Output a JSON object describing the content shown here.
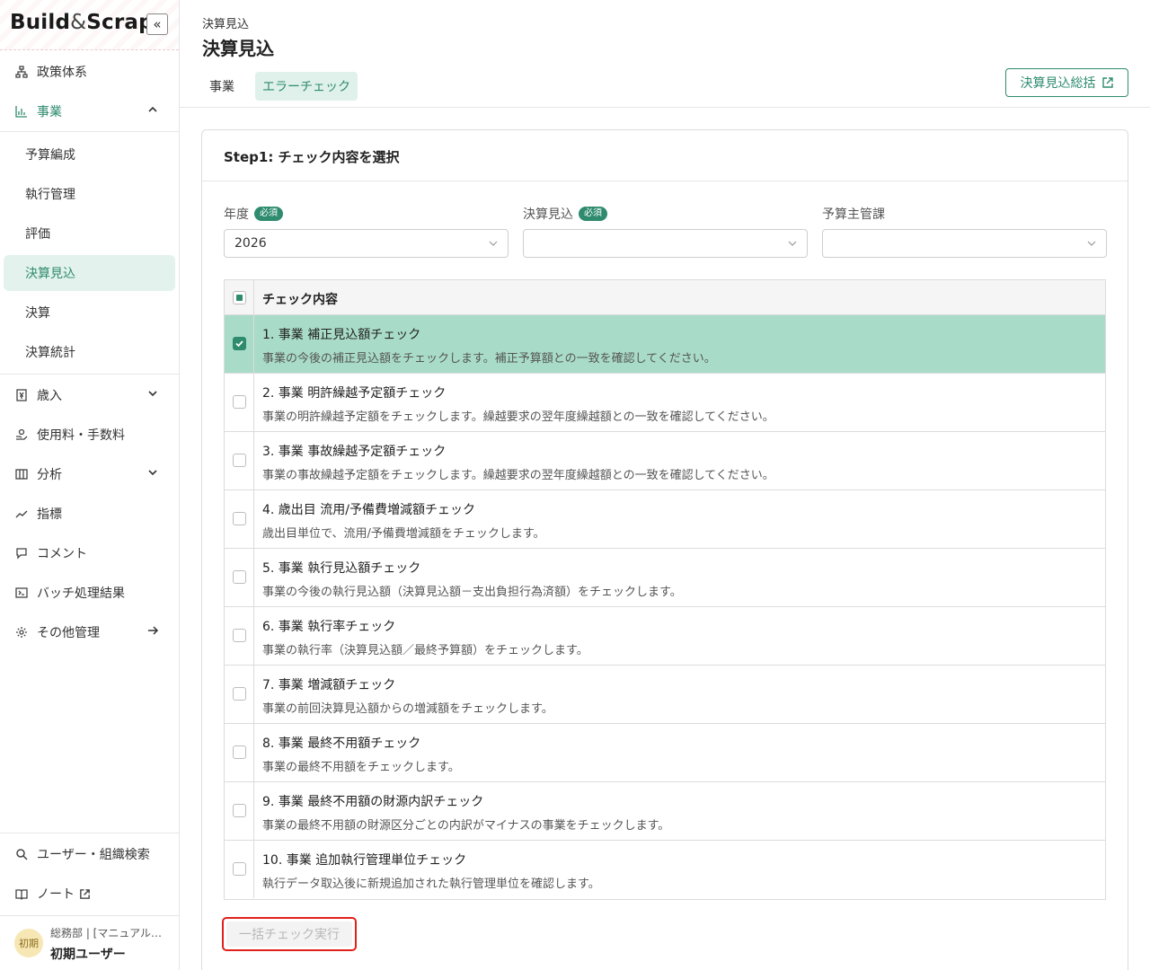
{
  "sidebar": {
    "logo_main": "Build",
    "logo_amp": "&",
    "logo_end": "Scrap",
    "collapse_label": "«",
    "items": [
      {
        "label": "政策体系"
      },
      {
        "label": "事業"
      },
      {
        "label": "歳入"
      },
      {
        "label": "使用料・手数料"
      },
      {
        "label": "分析"
      },
      {
        "label": "指標"
      },
      {
        "label": "コメント"
      },
      {
        "label": "バッチ処理結果"
      },
      {
        "label": "その他管理"
      }
    ],
    "sub_items": [
      {
        "label": "予算編成"
      },
      {
        "label": "執行管理"
      },
      {
        "label": "評価"
      },
      {
        "label": "決算見込"
      },
      {
        "label": "決算"
      },
      {
        "label": "決算統計"
      }
    ],
    "footer_items": [
      {
        "label": "ユーザー・組織検索"
      },
      {
        "label": "ノート"
      }
    ],
    "user": {
      "avatar_text": "初期",
      "dept": "総務部 | [マニュアル…",
      "name": "初期ユーザー"
    }
  },
  "header": {
    "breadcrumb": "決算見込",
    "title": "決算見込",
    "tabs": [
      {
        "label": "事業"
      },
      {
        "label": "エラーチェック"
      }
    ],
    "summary_button": "決算見込総括"
  },
  "card": {
    "title": "Step1: チェック内容を選択",
    "fields": [
      {
        "label": "年度",
        "required": "必須",
        "value": "2026"
      },
      {
        "label": "決算見込",
        "required": "必須",
        "value": ""
      },
      {
        "label": "予算主管課",
        "value": ""
      }
    ],
    "table_header": "チェック内容",
    "rows": [
      {
        "title": "1. 事業 補正見込額チェック",
        "desc": "事業の今後の補正見込額をチェックします。補正予算額との一致を確認してください。",
        "checked": true
      },
      {
        "title": "2. 事業 明許繰越予定額チェック",
        "desc": "事業の明許繰越予定額をチェックします。繰越要求の翌年度繰越額との一致を確認してください。",
        "checked": false
      },
      {
        "title": "3. 事業 事故繰越予定額チェック",
        "desc": "事業の事故繰越予定額をチェックします。繰越要求の翌年度繰越額との一致を確認してください。",
        "checked": false
      },
      {
        "title": "4. 歳出目 流用/予備費増減額チェック",
        "desc": "歳出目単位で、流用/予備費増減額をチェックします。",
        "checked": false
      },
      {
        "title": "5. 事業 執行見込額チェック",
        "desc": "事業の今後の執行見込額（決算見込額－支出負担行為済額）をチェックします。",
        "checked": false
      },
      {
        "title": "6. 事業 執行率チェック",
        "desc": "事業の執行率（決算見込額／最終予算額）をチェックします。",
        "checked": false
      },
      {
        "title": "7. 事業 増減額チェック",
        "desc": "事業の前回決算見込額からの増減額をチェックします。",
        "checked": false
      },
      {
        "title": "8. 事業 最終不用額チェック",
        "desc": "事業の最終不用額をチェックします。",
        "checked": false
      },
      {
        "title": "9. 事業 最終不用額の財源内訳チェック",
        "desc": "事業の最終不用額の財源区分ごとの内訳がマイナスの事業をチェックします。",
        "checked": false
      },
      {
        "title": "10. 事業 追加執行管理単位チェック",
        "desc": "執行データ取込後に新規追加された執行管理単位を確認します。",
        "checked": false
      }
    ],
    "run_button": "一括チェック実行"
  },
  "colors": {
    "accent": "#2e8b6e",
    "selected_row": "#a9dcc8",
    "active_tab_bg": "#dff1ea",
    "highlight_outline": "#e0201b"
  }
}
